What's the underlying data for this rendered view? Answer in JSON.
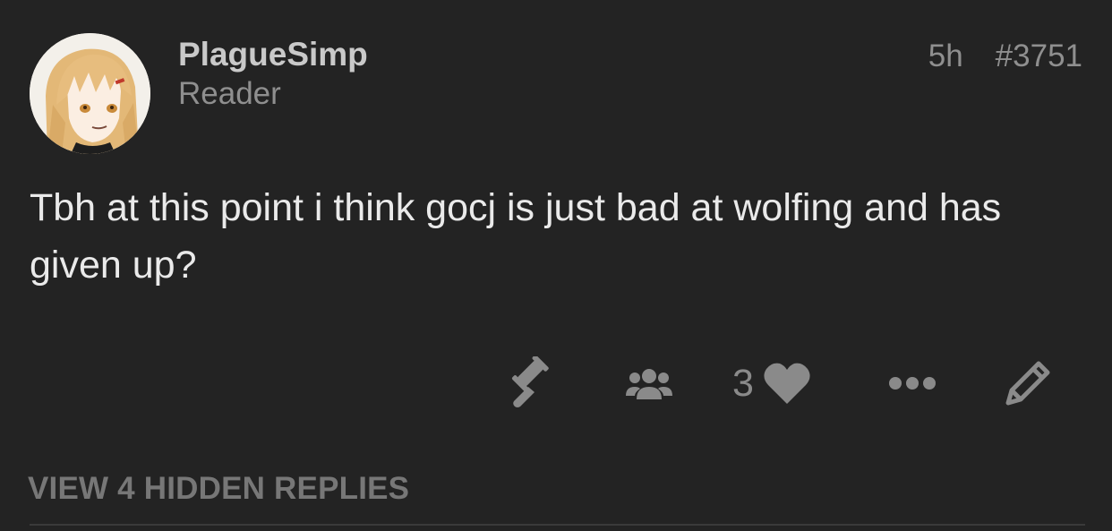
{
  "post": {
    "author": {
      "name": "PlagueSimp",
      "role": "Reader"
    },
    "time_ago": "5h",
    "post_number": "#3751",
    "body": "Tbh at this point i think gocj is just bad at wolfing and has given up?",
    "like_count": "3",
    "actions": {
      "moderate_icon": "gavel-icon",
      "users_icon": "users-icon",
      "like_icon": "heart-icon",
      "more_icon": "ellipsis-icon",
      "edit_icon": "pencil-icon"
    },
    "hidden_replies_label": "VIEW 4 HIDDEN REPLIES"
  },
  "colors": {
    "background": "#232323",
    "text_primary": "#eaeaea",
    "text_muted": "#8f8f8f",
    "icon": "#8a8a8a"
  }
}
